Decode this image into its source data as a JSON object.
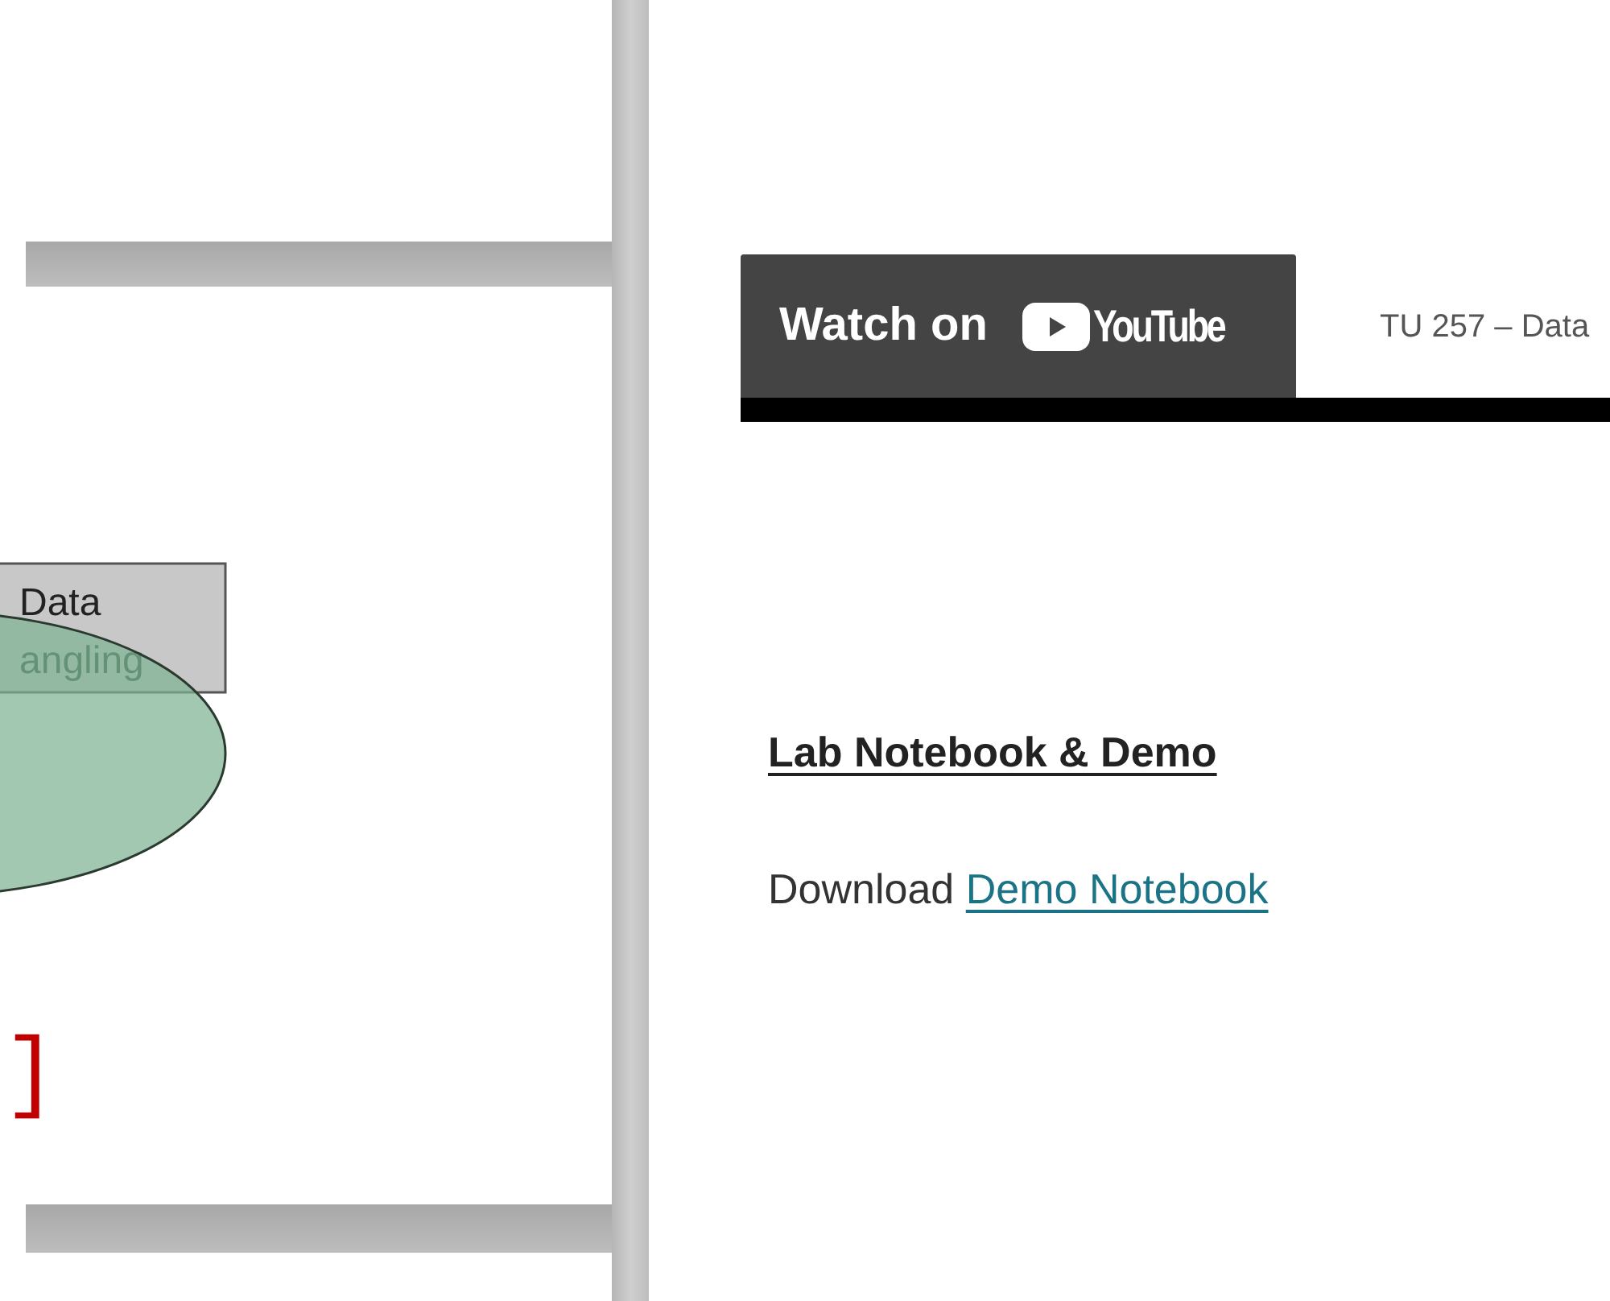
{
  "slide": {
    "box_lines": [
      "Data",
      "angling"
    ],
    "bracket": "]"
  },
  "video": {
    "watch_label": "Watch on",
    "brand": "YouTube",
    "title": "TU 257 – Data"
  },
  "section": {
    "heading": "Lab Notebook & Demo",
    "text": "Download",
    "link": "Demo Notebook"
  }
}
